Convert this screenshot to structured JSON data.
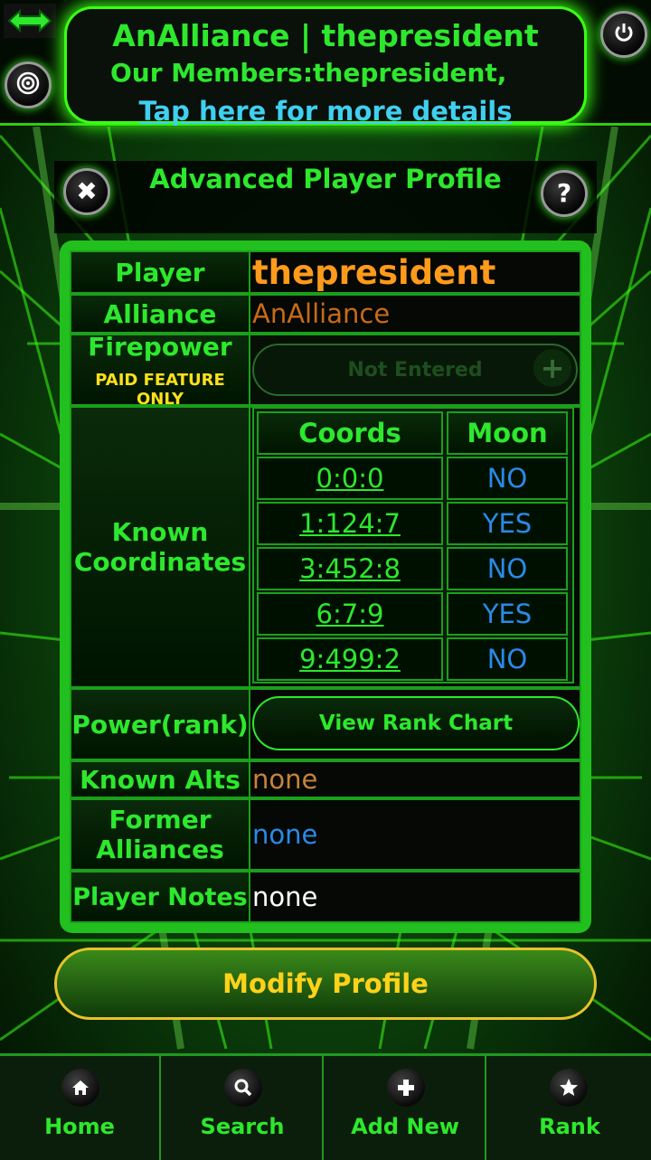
{
  "header": {
    "title": "AnAlliance | thepresident",
    "members": "Our Members:thepresident,",
    "details_link": "Tap here for more details"
  },
  "dialog": {
    "title": "Advanced Player Profile"
  },
  "profile": {
    "player_label": "Player",
    "player_value": "thepresident",
    "alliance_label": "Alliance",
    "alliance_value": "AnAlliance",
    "firepower_label": "Firepower",
    "paid_feature_label": "PAID FEATURE ONLY",
    "firepower_value": "Not Entered",
    "known_coords_label": [
      "Known",
      "Coordinates"
    ],
    "coords_header": "Coords",
    "moon_header": "Moon",
    "coordinates": [
      {
        "coords": "0:0:0",
        "moon": "NO"
      },
      {
        "coords": "1:124:7",
        "moon": "YES"
      },
      {
        "coords": "3:452:8",
        "moon": "NO"
      },
      {
        "coords": "6:7:9",
        "moon": "YES"
      },
      {
        "coords": "9:499:2",
        "moon": "NO"
      }
    ],
    "power_label": "Power(rank)",
    "rank_button": "View Rank Chart",
    "alts_label": "Known Alts",
    "alts_value": "none",
    "former_label": [
      "Former",
      "Alliances"
    ],
    "former_value": "none",
    "notes_label": "Player Notes",
    "notes_value": "none"
  },
  "modify_button": "Modify Profile",
  "nav": [
    {
      "label": "Home",
      "icon": "home-icon"
    },
    {
      "label": "Search",
      "icon": "search-icon"
    },
    {
      "label": "Add New",
      "icon": "plus-icon"
    },
    {
      "label": "Rank",
      "icon": "star-icon"
    }
  ],
  "colors": {
    "accent_green": "#2de82d",
    "player_orange": "#ff9a1a",
    "moon_blue": "#2a8ae8",
    "link_cyan": "#3fd0f0",
    "modify_gold": "#ffd21a"
  }
}
